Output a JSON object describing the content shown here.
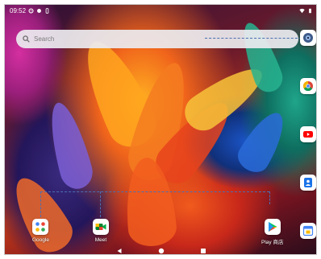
{
  "status_bar": {
    "time": "09:52",
    "left_icons": [
      "settings-icon",
      "notification-dot-icon",
      "battery-saver-icon"
    ],
    "right_icons": [
      "wifi-icon",
      "battery-icon"
    ]
  },
  "search": {
    "placeholder": "Search",
    "icon": "search-icon"
  },
  "dock_apps": [
    {
      "label": "Google",
      "icon": "google-folder-icon"
    },
    {
      "label": "Meet",
      "icon": "meet-icon"
    },
    {
      "label": "Play 商店",
      "icon": "play-store-icon"
    }
  ],
  "side_apps": [
    {
      "icon": "camera-icon"
    },
    {
      "icon": "chrome-icon"
    },
    {
      "icon": "youtube-icon"
    },
    {
      "icon": "contacts-icon"
    },
    {
      "icon": "calendar-icon"
    }
  ],
  "nav_bar": [
    "back-icon",
    "home-icon",
    "recents-icon"
  ],
  "colors": {
    "search_bg": "#ececf0",
    "highlight_dash": "#4a6fb3",
    "youtube_red": "#ff0000",
    "chrome_red": "#db4437"
  }
}
